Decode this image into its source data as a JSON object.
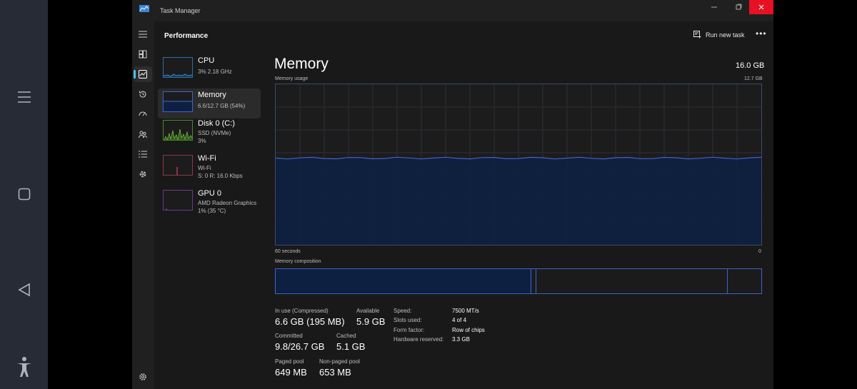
{
  "window": {
    "title": "Task Manager"
  },
  "header": {
    "page_title": "Performance",
    "run_new_task": "Run new task",
    "more": "•••"
  },
  "resources": [
    {
      "name": "CPU",
      "line1": "3%  2.18 GHz",
      "line2": ""
    },
    {
      "name": "Memory",
      "line1": "6.6/12.7 GB (54%)",
      "line2": ""
    },
    {
      "name": "Disk 0 (C:)",
      "line1": "SSD (NVMe)",
      "line2": "3%"
    },
    {
      "name": "Wi-Fi",
      "line1": "Wi-Fi",
      "line2": "S: 0  R: 16.0 Kbps"
    },
    {
      "name": "GPU 0",
      "line1": "AMD Radeon Graphics",
      "line2": "1%  (35 °C)"
    }
  ],
  "memory": {
    "title": "Memory",
    "total": "16.0 GB",
    "usage_label": "Memory usage",
    "usage_max": "12.7 GB",
    "time_left": "60 seconds",
    "time_right": "0",
    "composition_label": "Memory composition",
    "usage_fraction": 0.54
  },
  "stats": {
    "in_use_label": "In use (Compressed)",
    "in_use_value": "6.6 GB (195 MB)",
    "available_label": "Available",
    "available_value": "5.9 GB",
    "committed_label": "Committed",
    "committed_value": "9.8/26.7 GB",
    "cached_label": "Cached",
    "cached_value": "5.1 GB",
    "paged_label": "Paged pool",
    "paged_value": "649 MB",
    "nonpaged_label": "Non-paged pool",
    "nonpaged_value": "653 MB"
  },
  "details": [
    {
      "key": "Speed:",
      "value": "7500 MT/s"
    },
    {
      "key": "Slots used:",
      "value": "4 of 4"
    },
    {
      "key": "Form factor:",
      "value": "Row of chips"
    },
    {
      "key": "Hardware reserved:",
      "value": "3.3 GB"
    }
  ],
  "colors": {
    "accent": "#4cc2ff",
    "memory_fill": "#0e2041",
    "memory_line": "#3e64c8",
    "close": "#e81123"
  }
}
